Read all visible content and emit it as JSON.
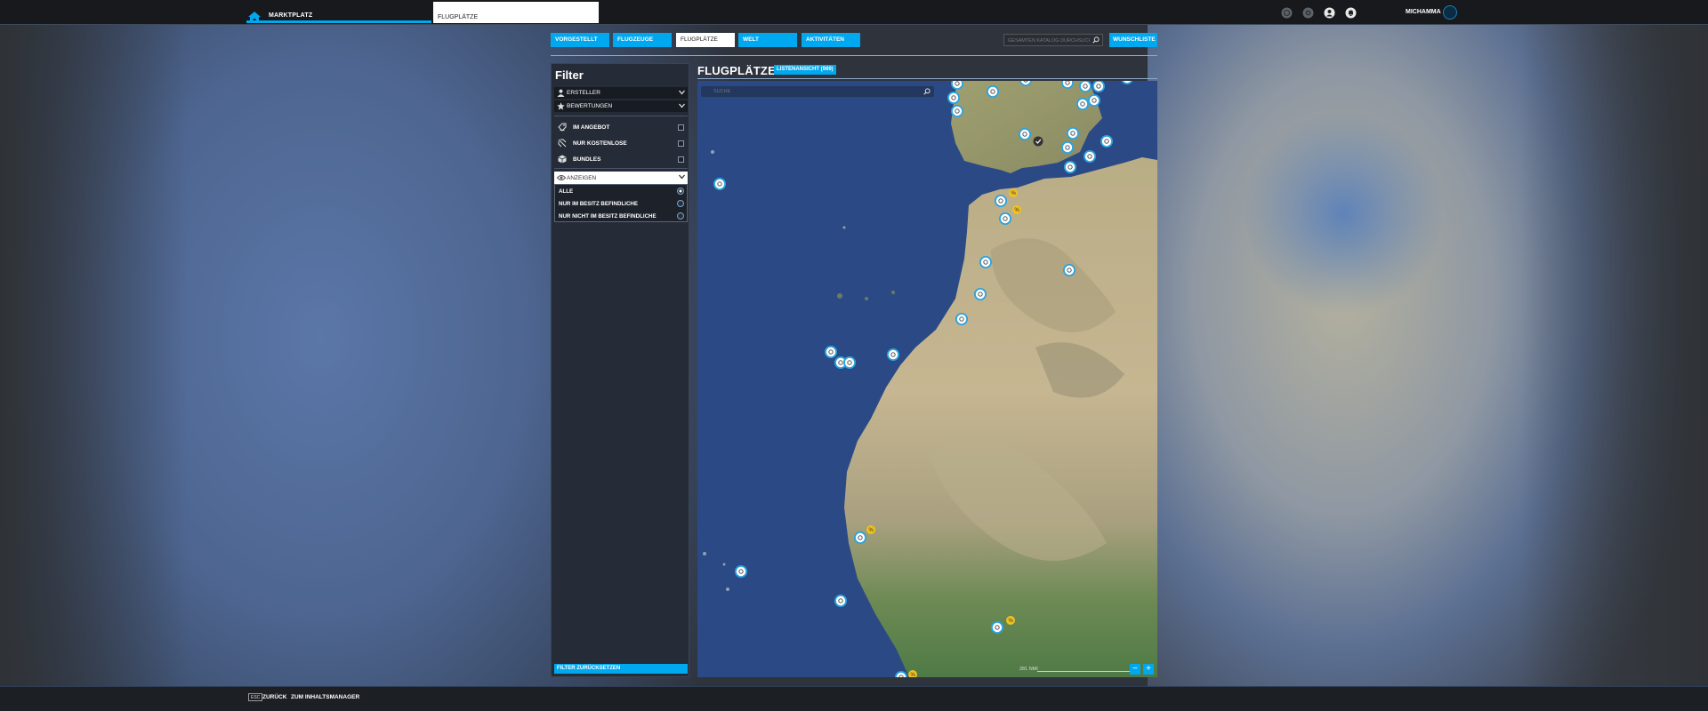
{
  "topbar": {
    "market_tab": "MARKTPLATZ",
    "current_tab": "FLUGPLÄTZE",
    "username": "MICHAMMA"
  },
  "nav": {
    "tabs": [
      {
        "label": "VORGESTELLT",
        "active": false
      },
      {
        "label": "FLUGZEUGE",
        "active": false
      },
      {
        "label": "FLUGPLÄTZE",
        "active": true
      },
      {
        "label": "WELT",
        "active": false
      },
      {
        "label": "AKTIVITÄTEN",
        "active": false
      }
    ],
    "search_placeholder": "GESAMTEN KATALOG DURCHSUCHEN",
    "wishlist": "WUNSCHLISTE"
  },
  "filter": {
    "title": "Filter",
    "dropdowns": {
      "creator": "ERSTELLER",
      "ratings": "BEWERTUNGEN"
    },
    "toggles": {
      "offer": "IM ANGEBOT",
      "free": "NUR KOSTENLOSE",
      "bundles": "BUNDLES"
    },
    "show": {
      "label": "ANZEIGEN",
      "options": [
        {
          "label": "ALLE",
          "selected": true
        },
        {
          "label": "NUR IM BESITZ BEFINDLICHE",
          "selected": false
        },
        {
          "label": "NUR NICHT IM BESITZ BEFINDLICHE",
          "selected": false
        }
      ]
    },
    "reset": "FILTER ZURÜCKSETZEN"
  },
  "map": {
    "title": "FLUGPLÄTZE",
    "list_view": "LISTENANSICHT (989)",
    "search_placeholder": "SUCHE",
    "scale": "281 NMI",
    "zoom_out": "−",
    "zoom_in": "+"
  },
  "bottombar": {
    "esc_key": "ESC",
    "back": "ZURÜCK",
    "content_manager": "ZUM INHALTSMANAGER"
  },
  "colors": {
    "accent": "#00a8ef",
    "panel": "#252b37",
    "ocean": "#2d4c86"
  }
}
